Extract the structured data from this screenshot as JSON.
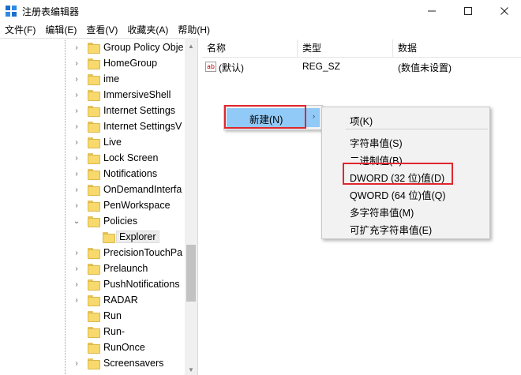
{
  "window": {
    "title": "注册表编辑器",
    "minimize_glyph": "—",
    "maximize_glyph": "☐",
    "close_glyph": "✕"
  },
  "menu": [
    "文件(F)",
    "编辑(E)",
    "查看(V)",
    "收藏夹(A)",
    "帮助(H)"
  ],
  "tree": {
    "items": [
      {
        "label": "Group Policy Obje",
        "expander": "›",
        "level": 1
      },
      {
        "label": "HomeGroup",
        "expander": "›",
        "level": 1
      },
      {
        "label": "ime",
        "expander": "›",
        "level": 1
      },
      {
        "label": "ImmersiveShell",
        "expander": "›",
        "level": 1
      },
      {
        "label": "Internet Settings",
        "expander": "›",
        "level": 1
      },
      {
        "label": "Internet SettingsV",
        "expander": "›",
        "level": 1
      },
      {
        "label": "Live",
        "expander": "›",
        "level": 1
      },
      {
        "label": "Lock Screen",
        "expander": "›",
        "level": 1
      },
      {
        "label": "Notifications",
        "expander": "›",
        "level": 1
      },
      {
        "label": "OnDemandInterfa",
        "expander": "›",
        "level": 1
      },
      {
        "label": "PenWorkspace",
        "expander": "›",
        "level": 1
      },
      {
        "label": "Policies",
        "expander": "⌄",
        "level": 1
      },
      {
        "label": "Explorer",
        "expander": "",
        "level": 2,
        "selected": true
      },
      {
        "label": "PrecisionTouchPa",
        "expander": "›",
        "level": 1
      },
      {
        "label": "Prelaunch",
        "expander": "›",
        "level": 1
      },
      {
        "label": "PushNotifications",
        "expander": "›",
        "level": 1
      },
      {
        "label": "RADAR",
        "expander": "›",
        "level": 1
      },
      {
        "label": "Run",
        "expander": "",
        "level": 1
      },
      {
        "label": "Run-",
        "expander": "",
        "level": 1
      },
      {
        "label": "RunOnce",
        "expander": "",
        "level": 1
      },
      {
        "label": "Screensavers",
        "expander": "›",
        "level": 1
      }
    ]
  },
  "columns": {
    "name": "名称",
    "type": "类型",
    "data": "数据"
  },
  "rows": [
    {
      "icon": "ab",
      "name": "(默认)",
      "type": "REG_SZ",
      "data": "(数值未设置)"
    }
  ],
  "context_menu": {
    "new_label": "新建(N)",
    "submenu_arrow": "›",
    "submenu": [
      "项(K)",
      "字符串值(S)",
      "二进制值(B)",
      "DWORD (32 位)值(D)",
      "QWORD (64 位)值(Q)",
      "多字符串值(M)",
      "可扩充字符串值(E)"
    ]
  },
  "colors": {
    "highlight": "#91c9f7",
    "annotation_red": "#e0262d",
    "folder_yellow": "#f7d96d"
  }
}
